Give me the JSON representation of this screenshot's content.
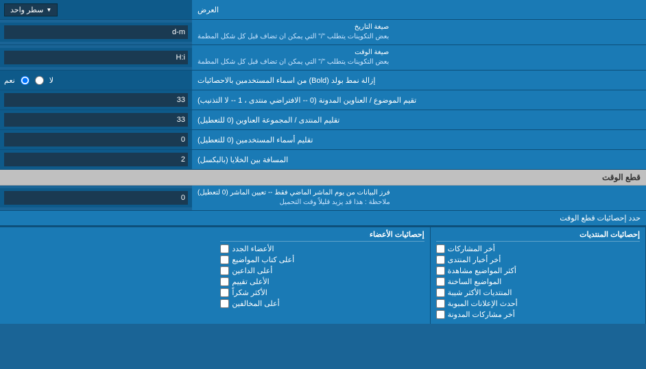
{
  "header": {
    "title": "العرض",
    "dropdown_label": "سطر واحد"
  },
  "rows": [
    {
      "id": "date_format",
      "label": "صيغة التاريخ",
      "sublabel": "بعض التكوينات يتطلب \"/\" التي يمكن ان تضاف قبل كل شكل المطمة",
      "value": "d-m"
    },
    {
      "id": "time_format",
      "label": "صيغة الوقت",
      "sublabel": "بعض التكوينات يتطلب \"/\" التي يمكن ان تضاف قبل كل شكل المطمة",
      "value": "H:i"
    },
    {
      "id": "bold_remove",
      "label": "إزالة نمط بولد (Bold) من اسماء المستخدمين بالاحصائيات",
      "type": "radio",
      "options": [
        "نعم",
        "لا"
      ],
      "selected": "نعم"
    },
    {
      "id": "topic_order",
      "label": "تقيم الموضوع / العناوين المدونة (0 -- الافتراضي منتدى ، 1 -- لا التذنيب)",
      "value": "33"
    },
    {
      "id": "forum_order",
      "label": "تقليم المنتدى / المجموعة العناوين (0 للتعطيل)",
      "value": "33"
    },
    {
      "id": "usernames_trim",
      "label": "تقليم أسماء المستخدمين (0 للتعطيل)",
      "value": "0"
    },
    {
      "id": "cell_spacing",
      "label": "المسافة بين الخلايا (بالبكسل)",
      "value": "2"
    }
  ],
  "cutoff_section": {
    "title": "قطع الوقت",
    "value": "0",
    "label": "فرز البيانات من يوم الماشر الماضي فقط -- تعيين الماشر (0 لتعطيل)",
    "note": "ملاحظة : هذا قد يزيد قليلاً وقت التحميل"
  },
  "checkboxes": {
    "limit_label": "حدد إحصائيات قطع الوقت",
    "col1": {
      "header": "إحصائيات المنتديات",
      "items": [
        "أخر المشاركات",
        "أخر أخبار المنتدى",
        "أكثر المواضيع مشاهدة",
        "المواضيع الساخنة",
        "المنتديات الأكثر شيبة",
        "أحدث الإعلانات المبوبة",
        "أخر مشاركات المدونة"
      ]
    },
    "col2": {
      "header": "إحصائيات الأعضاء",
      "items": [
        "الأعضاء الجدد",
        "أعلى كتاب المواضيع",
        "أعلى الداعين",
        "الأعلى تقييم",
        "الأكثر شكراً",
        "أعلى المخالفين"
      ]
    }
  }
}
